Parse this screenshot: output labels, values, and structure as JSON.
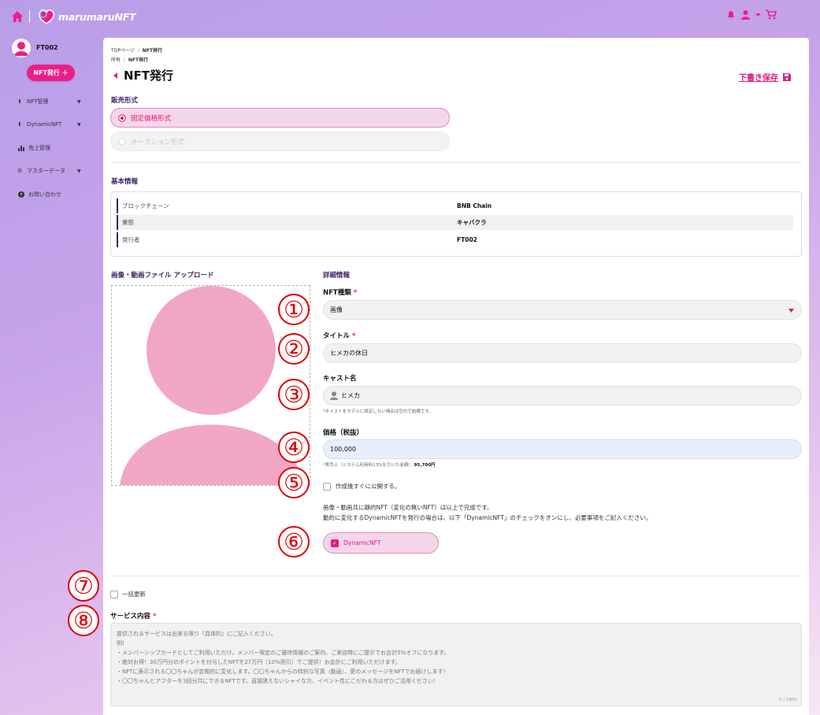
{
  "header": {
    "logo_text": "marumaruNFT",
    "icons": [
      "home-icon",
      "notification-icon",
      "user-icon",
      "chevron-down-icon",
      "cart-icon"
    ]
  },
  "sidebar": {
    "username": "FT002",
    "nft_issue_button": "NFT発行 ＋",
    "items": [
      {
        "label": "NFT管理",
        "icon": "upload-icon",
        "has_caret": true
      },
      {
        "label": "DynamicNFT",
        "icon": "upload-icon",
        "has_caret": true
      },
      {
        "label": "売上管理",
        "icon": "bar-chart-icon",
        "has_caret": false
      },
      {
        "label": "マスターデータ",
        "icon": "gear-icon",
        "has_caret": true
      },
      {
        "label": "お問い合わせ",
        "icon": "question-icon",
        "has_caret": false
      }
    ]
  },
  "breadcrumb": {
    "line1_a": "TOPページ",
    "sep": "/",
    "line1_b": "NFT発行",
    "line2_a": "所有",
    "line2_b": "NFT発行"
  },
  "page": {
    "title": "NFT発行",
    "draft_save": "下書き保存"
  },
  "sales_format": {
    "heading": "販売形式",
    "options": [
      "固定価格形式",
      "オークション形式"
    ],
    "selected": "固定価格形式"
  },
  "basic_info": {
    "heading": "基本情報",
    "rows": [
      {
        "label": "ブロックチェーン",
        "value": "BNB Chain"
      },
      {
        "label": "業態",
        "value": "キャバクラ"
      },
      {
        "label": "発行者",
        "value": "FT002"
      }
    ]
  },
  "upload": {
    "heading": "画像・動画ファイル アップロード"
  },
  "details": {
    "heading": "詳細情報",
    "nft_type": {
      "label": "NFT種類",
      "value": "画像"
    },
    "title_field": {
      "label": "タイトル",
      "value": "ヒメカの休日"
    },
    "cast": {
      "label": "キャスト名",
      "value": "ヒメカ",
      "hint": "*キャストをモデルに設定しない場合は空白で結構です。"
    },
    "price": {
      "label": "価格（税抜）",
      "value": "100,000",
      "hint_prefix": "*実売上（システム利用料13%を引いた金額）:",
      "hint_value": "95,700円"
    },
    "publish_checkbox": "作成後すぐに公開する。",
    "note_line1": "画像・動画共に静的NFT（変化の無いNFT）は以上で完成です。",
    "note_line2": "動的に変化するDynamicNFTを発行の場合は、以下「DynamicNFT」のチェックをオンにし、必要事項をご記入ください。",
    "dynamic_nft": "DynamicNFT"
  },
  "bulk_update": "一括更新",
  "service": {
    "label": "サービス内容",
    "placeholder_lines": [
      "提供されるサービスは出来る限り『具体的』にご記入ください。",
      "例)",
      "・メンバーシップカードとしてご利用いただけ、メンバー限定のご優待情報のご案内、ご来店時にご提示でお会計5%オフになります。",
      "・絶対お得！30万円分のポイントを付与したNFTを27万円（10%割引）でご提供！お会計にご利用いただけます。",
      "・NFTに表示される〇〇ちゃんが定期的に変化します。〇〇ちゃんからの特別な写真（動画）、愛のメッセージをNFTでお届けします！",
      "・〇〇ちゃんとアフターを3回分共にできるNFTです。直接誘えないシャイな方、イベント性にこだわる方はぜひご活用ください！"
    ],
    "char_count": "0 / 1000"
  },
  "annotations": [
    "①",
    "②",
    "③",
    "④",
    "⑤",
    "⑥",
    "⑦",
    "⑧"
  ],
  "colors": {
    "accent": "#e0197d",
    "heading": "#3d2466",
    "selected_bg": "#f4d6ea",
    "annotation": "#e00000"
  }
}
